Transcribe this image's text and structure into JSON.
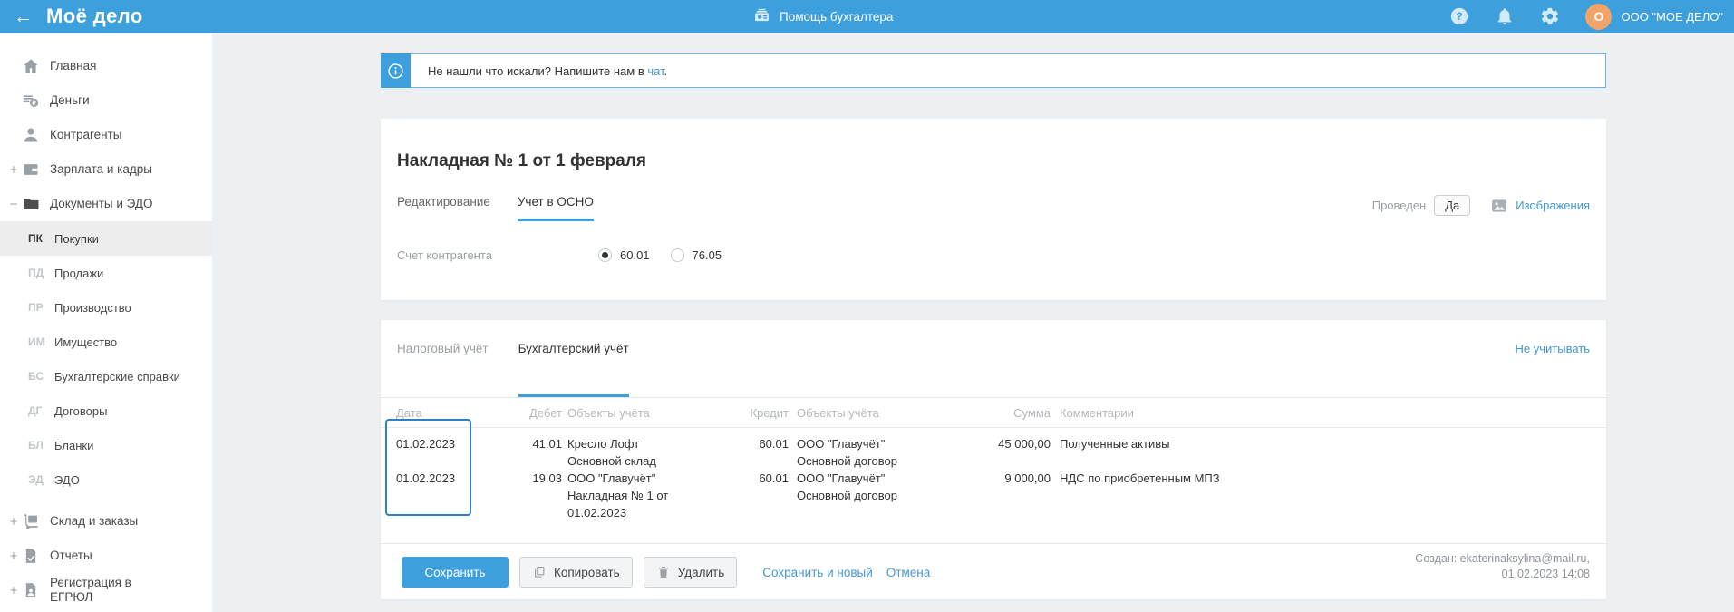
{
  "header": {
    "logo": "Моё дело",
    "help_link": "Помощь бухгалтера",
    "company": "ООО \"МОЕ ДЕЛО\"",
    "avatar_letter": "O"
  },
  "sidebar": {
    "items": [
      {
        "label": "Главная"
      },
      {
        "label": "Деньги"
      },
      {
        "label": "Контрагенты"
      },
      {
        "label": "Зарплата и кадры",
        "expander": "+"
      },
      {
        "label": "Документы и ЭДО",
        "expander": "−"
      },
      {
        "label": "Склад и заказы",
        "expander": "+"
      },
      {
        "label": "Отчеты",
        "expander": "+"
      },
      {
        "label": "Регистрация в ЕГРЮЛ",
        "expander": "+"
      }
    ],
    "subitems": [
      {
        "code": "ПК",
        "label": "Покупки"
      },
      {
        "code": "ПД",
        "label": "Продажи"
      },
      {
        "code": "ПР",
        "label": "Производство"
      },
      {
        "code": "ИМ",
        "label": "Имущество"
      },
      {
        "code": "БС",
        "label": "Бухгалтерские справки"
      },
      {
        "code": "ДГ",
        "label": "Договоры"
      },
      {
        "code": "БЛ",
        "label": "Бланки"
      },
      {
        "code": "ЭД",
        "label": "ЭДО"
      }
    ]
  },
  "banner": {
    "text": "Не нашли что искали? Напишите нам в",
    "link": "чат",
    "suffix": "."
  },
  "document": {
    "title": "Накладная № 1 от 1 февраля",
    "tab_edit": "Редактирование",
    "tab_osno": "Учет в ОСНО",
    "posted_label": "Проведен",
    "posted_value": "Да",
    "images_link": "Изображения",
    "account_label": "Счет контрагента",
    "account_option_1": "60.01",
    "account_option_2": "76.05",
    "account_selected": "60.01"
  },
  "accounting": {
    "tab_tax": "Налоговый учёт",
    "tab_book": "Бухгалтерский учёт",
    "ignore_link": "Не учитывать",
    "headers": {
      "date": "Дата",
      "debit": "Дебет",
      "debit_objects": "Объекты учёта",
      "credit": "Кредит",
      "credit_objects": "Объекты учёта",
      "amount": "Сумма",
      "comment": "Комментарии"
    },
    "rows": [
      {
        "date": "01.02.2023",
        "debit": "41.01",
        "debit_obj_1": "Кресло Лофт",
        "debit_obj_2": "Основной склад",
        "debit_obj_3": "",
        "credit": "60.01",
        "credit_obj_1": "ООО \"Главучёт\"",
        "credit_obj_2": "Основной договор",
        "amount": "45 000,00",
        "comment": "Полученные активы"
      },
      {
        "date": "01.02.2023",
        "debit": "19.03",
        "debit_obj_1": "ООО \"Главучёт\"",
        "debit_obj_2": "Накладная № 1 от",
        "debit_obj_3": "01.02.2023",
        "credit": "60.01",
        "credit_obj_1": "ООО \"Главучёт\"",
        "credit_obj_2": "Основной договор",
        "amount": "9 000,00",
        "comment": "НДС по приобретенным МПЗ"
      }
    ],
    "actions": {
      "save": "Сохранить",
      "copy": "Копировать",
      "delete": "Удалить",
      "save_new": "Сохранить и новый",
      "cancel": "Отмена"
    },
    "created_line_1": "Создан: ekaterinaksylina@mail.ru,",
    "created_line_2": "01.02.2023 14:08"
  },
  "colors": {
    "accent": "#3da0dc",
    "link": "#4596d2",
    "avatar_orange": "#f2a368",
    "focus_outline": "#2f80c9"
  }
}
